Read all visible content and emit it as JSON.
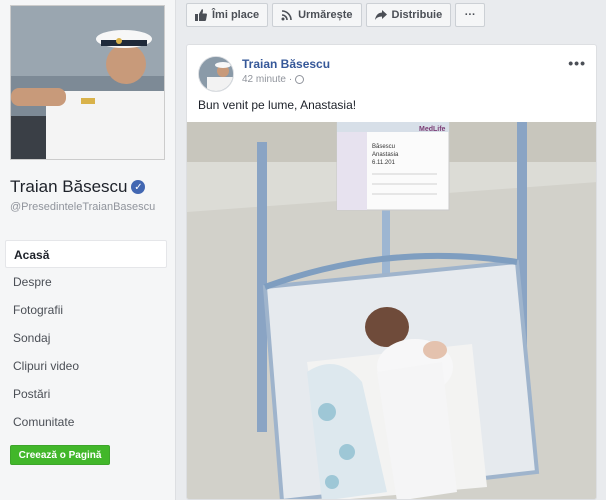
{
  "colors": {
    "accent": "#4267b2",
    "link": "#365899",
    "create_button": "#42b72a",
    "background": "#e9ebee"
  },
  "sidebar": {
    "page_name": "Traian Băsescu",
    "verified_icon": "verified-badge-icon",
    "handle": "@PresedinteleTraianBasescu",
    "nav": [
      {
        "label": "Acasă",
        "active": true
      },
      {
        "label": "Despre"
      },
      {
        "label": "Fotografii"
      },
      {
        "label": "Sondaj"
      },
      {
        "label": "Clipuri video"
      },
      {
        "label": "Postări"
      },
      {
        "label": "Comunitate"
      }
    ],
    "create_page_label": "Creează o Pagină"
  },
  "actions": {
    "like_label": "Îmi place",
    "follow_label": "Urmărește",
    "share_label": "Distribuie",
    "more_label": "···"
  },
  "post": {
    "author": "Traian Băsescu",
    "time": "42 minute",
    "separator": "·",
    "privacy_icon": "globe-icon",
    "menu_label": "•••",
    "text": "Bun venit pe lume, Anastasia!",
    "photo_card": {
      "brand": "MedLife",
      "lines": [
        "Băsescu",
        "Anastasia",
        "6.11.201"
      ]
    }
  }
}
